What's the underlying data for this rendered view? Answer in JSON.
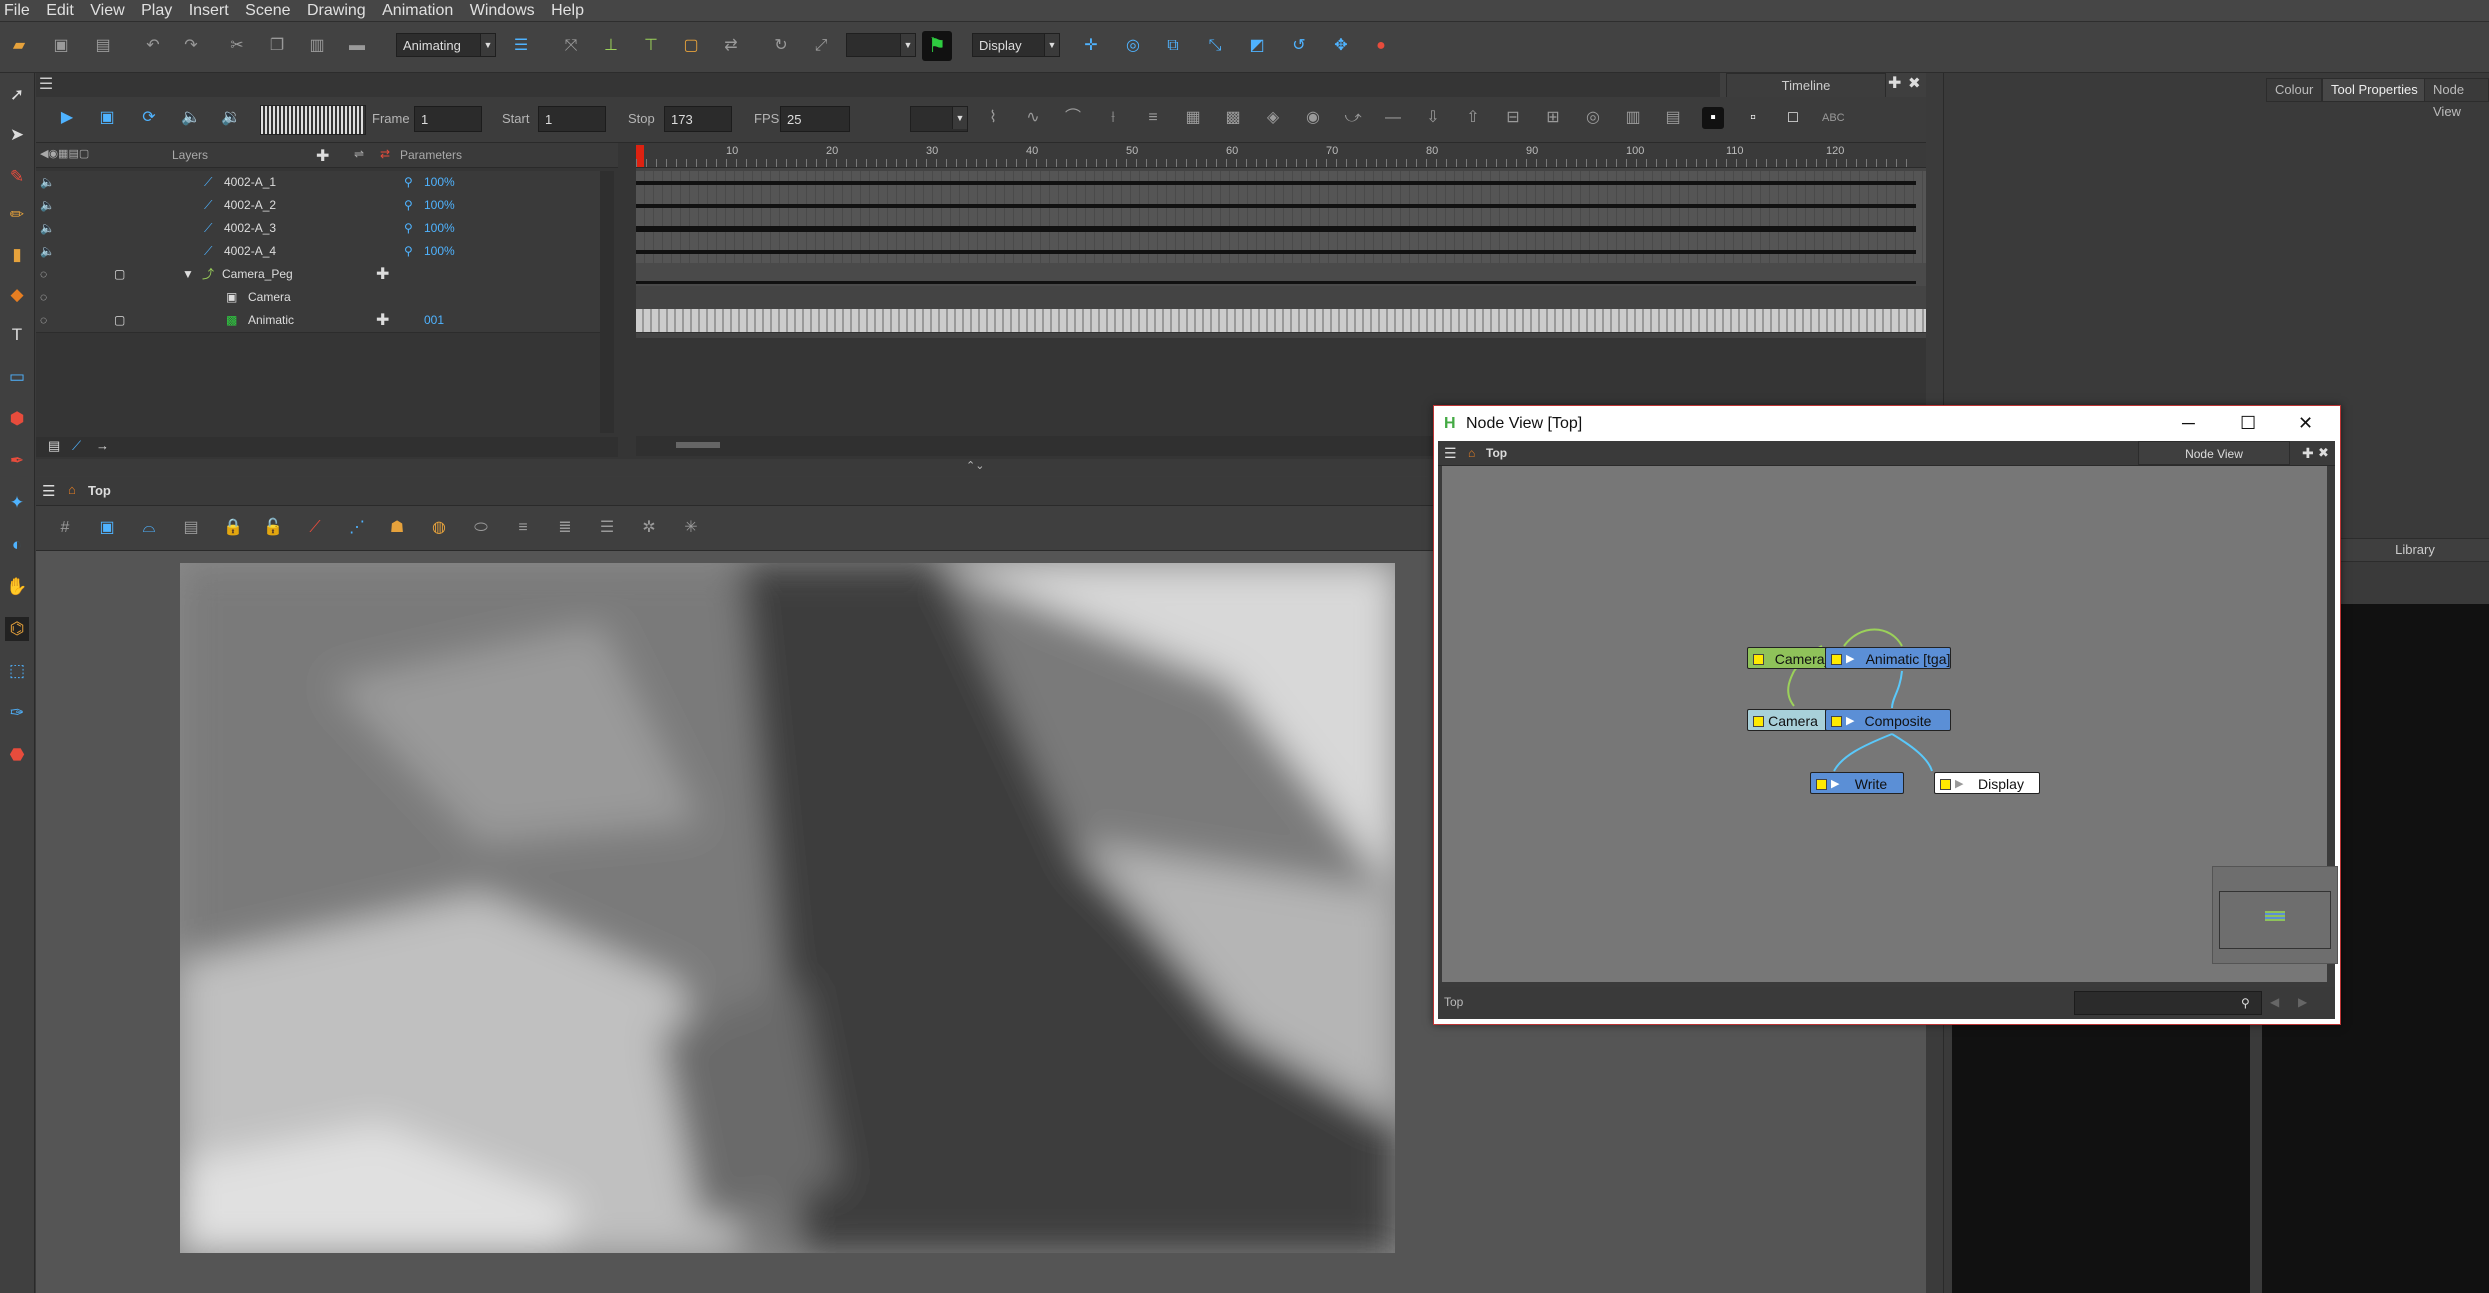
{
  "menu": [
    "File",
    "Edit",
    "View",
    "Play",
    "Insert",
    "Scene",
    "Drawing",
    "Animation",
    "Windows",
    "Help"
  ],
  "toolbar": {
    "mode": "Animating",
    "display": "Display"
  },
  "timeline": {
    "tab": "Timeline",
    "frame_label": "Frame",
    "frame_value": "1",
    "start_label": "Start",
    "start_value": "1",
    "stop_label": "Stop",
    "stop_value": "173",
    "fps_label": "FPS",
    "fps_value": "25",
    "layers_header": "Layers",
    "params_header": "Parameters",
    "ruler": [
      "10",
      "20",
      "30",
      "40",
      "50",
      "60",
      "70",
      "80",
      "90",
      "100",
      "110",
      "120"
    ],
    "layers": [
      {
        "name": "4002-A_1",
        "param": "100%"
      },
      {
        "name": "4002-A_2",
        "param": "100%"
      },
      {
        "name": "4002-A_3",
        "param": "100%"
      },
      {
        "name": "4002-A_4",
        "param": "100%"
      },
      {
        "name": "Camera_Peg",
        "param": ""
      },
      {
        "name": "Camera",
        "param": ""
      },
      {
        "name": "Animatic",
        "param": "001"
      }
    ]
  },
  "stage": {
    "title": "Top"
  },
  "right_panel": {
    "tabs": [
      "Colour",
      "Tool Properties",
      "Node View"
    ],
    "library": "Library"
  },
  "node_view_window": {
    "title": "Node View [Top]",
    "breadcrumb": "Top",
    "tab": "Node View",
    "footer": "Top",
    "nodes": {
      "camera_peg": "Camera_Peg",
      "animatic": "Animatic [tga]",
      "camera": "Camera",
      "composite": "Composite",
      "write": "Write",
      "display": "Display"
    }
  }
}
